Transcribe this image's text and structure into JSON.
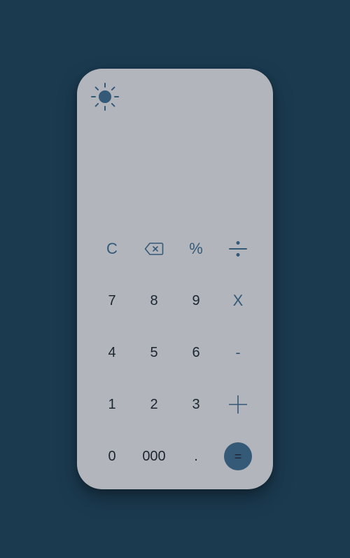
{
  "theme_toggle": {
    "icon": "sun-icon"
  },
  "display": {
    "expression": "",
    "result": ""
  },
  "keys": {
    "clear": "C",
    "backspace": {
      "icon": "backspace-icon"
    },
    "percent": "%",
    "divide": {
      "icon": "divide-icon"
    },
    "seven": "7",
    "eight": "8",
    "nine": "9",
    "multiply": "X",
    "four": "4",
    "five": "5",
    "six": "6",
    "minus": "-",
    "one": "1",
    "two": "2",
    "three": "3",
    "plus": {
      "icon": "plus-icon"
    },
    "zero": "0",
    "triple_zero": "000",
    "decimal": ".",
    "equals": "="
  },
  "colors": {
    "background": "#1b3a50",
    "panel": "#b2b5bc",
    "accent": "#355a78",
    "digit_text": "#1c2630"
  }
}
